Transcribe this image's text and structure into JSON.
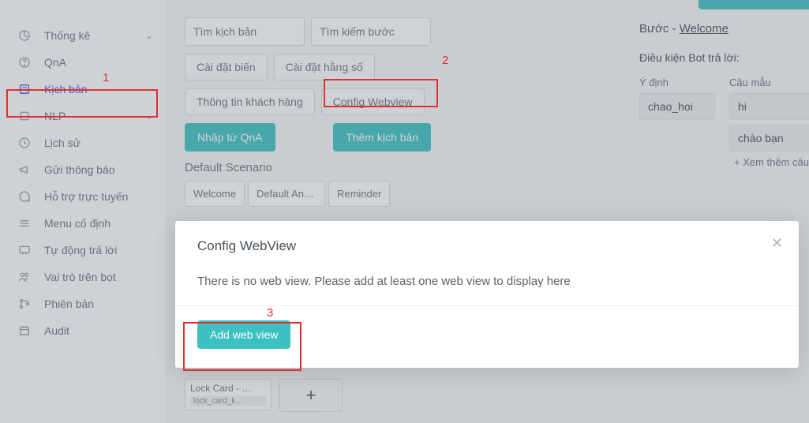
{
  "sidebar": {
    "items": [
      {
        "label": "Thống kê",
        "chev": true
      },
      {
        "label": "QnA"
      },
      {
        "label": "Kịch bản",
        "active": true
      },
      {
        "label": "NLP",
        "chev": true
      },
      {
        "label": "Lịch sử"
      },
      {
        "label": "Gửi thông báo"
      },
      {
        "label": "Hỗ trợ trực tuyến"
      },
      {
        "label": "Menu cố định"
      },
      {
        "label": "Tự động trả lời"
      },
      {
        "label": "Vai trò trên bot"
      },
      {
        "label": "Phiên bản"
      },
      {
        "label": "Audit"
      }
    ]
  },
  "search": {
    "placeholder_script": "Tìm kịch bản",
    "placeholder_step": "Tìm kiếm bước"
  },
  "buttons_row1": [
    "Cài đặt biến",
    "Cài đặt hằng số"
  ],
  "buttons_row2": [
    "Thông tin khách hàng",
    "Config Webview"
  ],
  "action_buttons": {
    "import": "Nhập từ QnA",
    "add": "Thêm kịch bản"
  },
  "default_scenario_title": "Default Scenario",
  "scenario_tabs": [
    "Welcome",
    "Default Ans…",
    "Reminder"
  ],
  "lock_card": {
    "title": "Lock Card - …",
    "sub": "lock_card_k…"
  },
  "step": {
    "prefix": "Bước - ",
    "name": "Welcome",
    "cond_label": "Điều kiện Bot trả lời:",
    "col1": "Ý định",
    "col2": "Câu mẫu",
    "intent": "chao_hoi",
    "sample1": "hi",
    "sample2": "chào bạn",
    "add_more": "+ Xem thêm câu mẫu"
  },
  "modal": {
    "title": "Config WebView",
    "text": "There is no web view. Please add at least one web view to display here",
    "button": "Add web view"
  },
  "annotations": {
    "a1": "1",
    "a2": "2",
    "a3": "3"
  }
}
